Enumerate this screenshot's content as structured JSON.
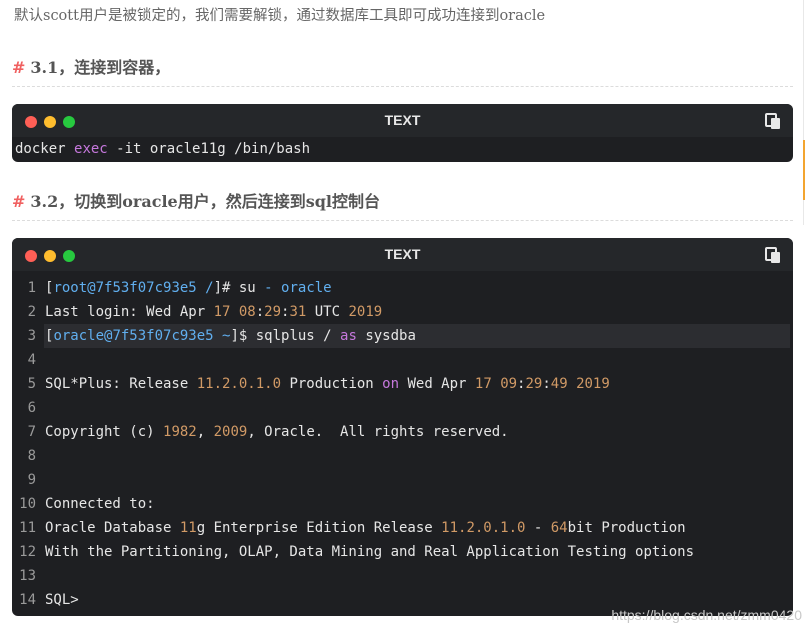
{
  "intro_text": "默认scott用户是被锁定的，我们需要解锁，通过数据库工具即可成功连接到oracle",
  "section1": {
    "hash": "#",
    "title": "3.1，连接到容器，"
  },
  "section2": {
    "hash": "#",
    "title": "3.2，切换到oracle用户，然后连接到sql控制台"
  },
  "code1": {
    "language_label": "TEXT",
    "tokens": [
      "docker ",
      "exec",
      " -it oracle11g /bin/bash"
    ]
  },
  "code2": {
    "language_label": "TEXT",
    "line_numbers": [
      "1",
      "2",
      "3",
      "4",
      "5",
      "6",
      "7",
      "8",
      "9",
      "10",
      "11",
      "12",
      "13",
      "14"
    ],
    "lines": [
      {
        "segments": [
          {
            "t": "[",
            "c": ""
          },
          {
            "t": "root@7f53f07c93e5 /",
            "c": "blue"
          },
          {
            "t": "]# su ",
            "c": ""
          },
          {
            "t": "- oracle",
            "c": "blue"
          }
        ]
      },
      {
        "segments": [
          {
            "t": "Last login: Wed Apr ",
            "c": ""
          },
          {
            "t": "17",
            "c": "num"
          },
          {
            "t": " ",
            "c": ""
          },
          {
            "t": "08",
            "c": "num"
          },
          {
            "t": ":",
            "c": ""
          },
          {
            "t": "29",
            "c": "num"
          },
          {
            "t": ":",
            "c": ""
          },
          {
            "t": "31",
            "c": "num"
          },
          {
            "t": " UTC ",
            "c": ""
          },
          {
            "t": "2019",
            "c": "num"
          }
        ]
      },
      {
        "segments": [
          {
            "t": "[",
            "c": ""
          },
          {
            "t": "oracle@7f53f07c93e5 ~",
            "c": "blue"
          },
          {
            "t": "]$ sqlplus / ",
            "c": ""
          },
          {
            "t": "as",
            "c": "kw"
          },
          {
            "t": " sysdba",
            "c": ""
          }
        ]
      },
      {
        "segments": []
      },
      {
        "segments": [
          {
            "t": "SQL*Plus: Release ",
            "c": ""
          },
          {
            "t": "11.2.0.1.0",
            "c": "num"
          },
          {
            "t": " Production ",
            "c": ""
          },
          {
            "t": "on",
            "c": "kw"
          },
          {
            "t": " Wed Apr ",
            "c": ""
          },
          {
            "t": "17",
            "c": "num"
          },
          {
            "t": " ",
            "c": ""
          },
          {
            "t": "09",
            "c": "num"
          },
          {
            "t": ":",
            "c": ""
          },
          {
            "t": "29",
            "c": "num"
          },
          {
            "t": ":",
            "c": ""
          },
          {
            "t": "49",
            "c": "num"
          },
          {
            "t": " ",
            "c": ""
          },
          {
            "t": "2019",
            "c": "num"
          }
        ]
      },
      {
        "segments": []
      },
      {
        "segments": [
          {
            "t": "Copyright (c) ",
            "c": ""
          },
          {
            "t": "1982",
            "c": "num"
          },
          {
            "t": ", ",
            "c": ""
          },
          {
            "t": "2009",
            "c": "num"
          },
          {
            "t": ", Oracle.  All rights reserved.",
            "c": ""
          }
        ]
      },
      {
        "segments": []
      },
      {
        "segments": []
      },
      {
        "segments": [
          {
            "t": "Connected to:",
            "c": ""
          }
        ]
      },
      {
        "segments": [
          {
            "t": "Oracle Database ",
            "c": ""
          },
          {
            "t": "11",
            "c": "num"
          },
          {
            "t": "g Enterprise Edition Release ",
            "c": ""
          },
          {
            "t": "11.2.0.1.0",
            "c": "num"
          },
          {
            "t": " - ",
            "c": ""
          },
          {
            "t": "64",
            "c": "num"
          },
          {
            "t": "bit Production",
            "c": ""
          }
        ]
      },
      {
        "segments": [
          {
            "t": "With the Partitioning, OLAP, Data Mining and Real Application Testing options",
            "c": ""
          }
        ]
      },
      {
        "segments": []
      },
      {
        "segments": [
          {
            "t": "SQL>",
            "c": ""
          }
        ]
      }
    ],
    "highlighted_line": 3
  },
  "colors": {
    "keyword": "#c678dd",
    "number": "#d19a66",
    "prompt": "#61afef",
    "code_bg": "#1e1f22",
    "hash": "#f06060"
  },
  "icons": {
    "window_controls": "traffic-light-dots",
    "copy": "copy-icon"
  },
  "watermark": "https://blog.csdn.net/zmm0420"
}
